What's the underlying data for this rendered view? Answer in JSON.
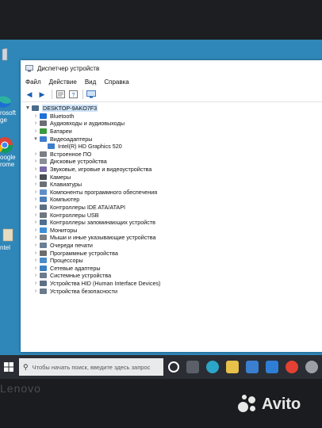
{
  "window": {
    "title": "Диспетчер устройств"
  },
  "menu": [
    "Файл",
    "Действие",
    "Вид",
    "Справка"
  ],
  "toolbar": [
    "back-icon",
    "forward-icon",
    "properties-icon",
    "help-icon",
    "monitor-icon"
  ],
  "tree": {
    "root": "DESKTOP-9AKO7F3",
    "categories": [
      {
        "label": "Bluetooth",
        "expanded": false
      },
      {
        "label": "Аудиовходы и аудиовыходы",
        "expanded": false
      },
      {
        "label": "Батареи",
        "expanded": false
      },
      {
        "label": "Видеоадаптеры",
        "expanded": true,
        "children": [
          "Intel(R) HD Graphics 520"
        ]
      },
      {
        "label": "Встроенное ПО",
        "expanded": false
      },
      {
        "label": "Дисковые устройства",
        "expanded": false
      },
      {
        "label": "Звуковые, игровые и видеоустройства",
        "expanded": false
      },
      {
        "label": "Камеры",
        "expanded": false
      },
      {
        "label": "Клавиатуры",
        "expanded": false
      },
      {
        "label": "Компоненты программного обеспечения",
        "expanded": false
      },
      {
        "label": "Компьютер",
        "expanded": false
      },
      {
        "label": "Контроллеры IDE ATA/ATAPI",
        "expanded": false
      },
      {
        "label": "Контроллеры USB",
        "expanded": false
      },
      {
        "label": "Контроллеры запоминающих устройств",
        "expanded": false
      },
      {
        "label": "Мониторы",
        "expanded": false
      },
      {
        "label": "Мыши и иные указывающие устройства",
        "expanded": false
      },
      {
        "label": "Очереди печати",
        "expanded": false
      },
      {
        "label": "Программные устройства",
        "expanded": false
      },
      {
        "label": "Процессоры",
        "expanded": false
      },
      {
        "label": "Сетевые адаптеры",
        "expanded": false
      },
      {
        "label": "Системные устройства",
        "expanded": false
      },
      {
        "label": "Устройства HID (Human Interface Devices)",
        "expanded": false
      },
      {
        "label": "Устройства безопасности",
        "expanded": false
      }
    ]
  },
  "desktop": {
    "icons": [
      {
        "label": "",
        "icon": "recycle-bin-icon"
      },
      {
        "label": "rosoft\nge",
        "icon": "edge-icon"
      },
      {
        "label": "oogle\nrome",
        "icon": "chrome-icon"
      },
      {
        "label": "ntel",
        "icon": "folder-icon"
      }
    ]
  },
  "taskbar": {
    "search_placeholder": "Чтобы начать поиск, введите здесь запрос",
    "icons": [
      "cortana-icon",
      "task-view-icon",
      "edge-icon",
      "file-explorer-icon",
      "store-icon",
      "mail-icon",
      "chrome-icon",
      "settings-icon"
    ]
  },
  "bezel": {
    "brand": "Lenovo"
  },
  "watermark": "Avito",
  "colors": {
    "desktop": "#2f86b8",
    "taskbar": "#2a2d33",
    "accent": "#1b5fb5"
  }
}
